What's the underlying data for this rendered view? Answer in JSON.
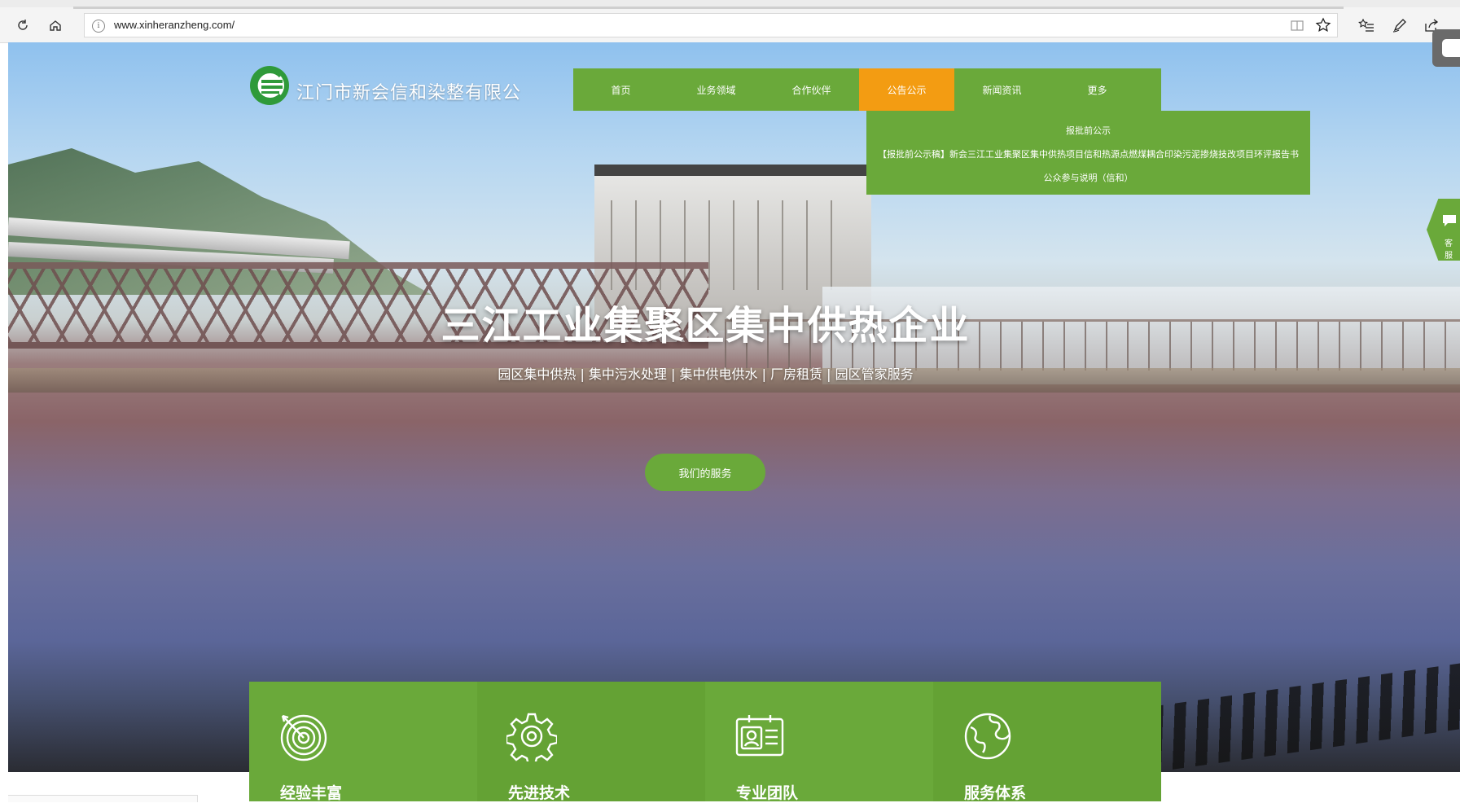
{
  "browser": {
    "url": "www.xinheranzheng.com/",
    "icons": [
      "refresh-icon",
      "home-icon",
      "info-icon",
      "reading-view-icon",
      "favorite-star-icon",
      "favorites-list-icon",
      "pen-icon",
      "share-icon"
    ]
  },
  "site": {
    "company_name": "江门市新会信和染整有限公",
    "nav": [
      {
        "label": "首页",
        "active": false
      },
      {
        "label": "业务领域",
        "active": false
      },
      {
        "label": "合作伙伴",
        "active": false
      },
      {
        "label": "公告公示",
        "active": true
      },
      {
        "label": "新闻资讯",
        "active": false
      },
      {
        "label": "更多",
        "active": false
      }
    ],
    "dropdown": [
      "报批前公示",
      "【报批前公示稿】新会三江工业集聚区集中供热项目信和热源点燃煤耦合印染污泥掺烧技改项目环评报告书",
      "公众参与说明（信和）"
    ],
    "hero_title": "三江工业集聚区集中供热企业",
    "hero_subtitle": "园区集中供热 | 集中污水处理 | 集中供电供水 | 厂房租赁 | 园区管家服务",
    "cta": "我们的服务",
    "side_chat_label": "客服",
    "features": [
      {
        "label": "经验丰富",
        "icon": "target-icon"
      },
      {
        "label": "先进技术",
        "icon": "gear-icon"
      },
      {
        "label": "专业团队",
        "icon": "id-card-icon"
      },
      {
        "label": "服务体系",
        "icon": "globe-icon"
      }
    ],
    "colors": {
      "brand_green": "#6aa93a",
      "active_orange": "#f39c12"
    }
  }
}
